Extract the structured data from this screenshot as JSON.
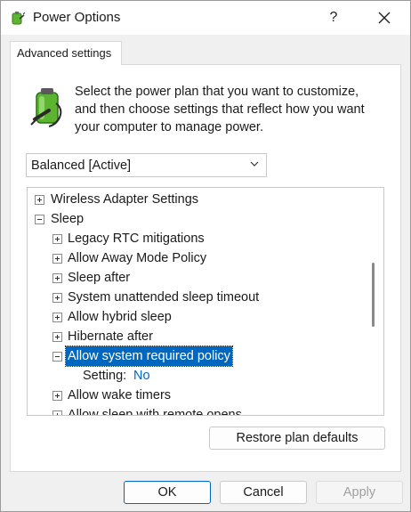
{
  "window": {
    "title": "Power Options",
    "help_label": "?"
  },
  "tab": {
    "label": "Advanced settings"
  },
  "description": "Select the power plan that you want to customize, and then choose settings that reflect how you want your computer to manage power.",
  "plan_select": {
    "value": "Balanced [Active]"
  },
  "tree": {
    "rows": [
      {
        "label": "Wireless Adapter Settings",
        "expander": "plus"
      },
      {
        "label": "Sleep",
        "expander": "minus"
      },
      {
        "label": "Legacy RTC mitigations",
        "expander": "plus"
      },
      {
        "label": "Allow Away Mode Policy",
        "expander": "plus"
      },
      {
        "label": "Sleep after",
        "expander": "plus"
      },
      {
        "label": "System unattended sleep timeout",
        "expander": "plus"
      },
      {
        "label": "Allow hybrid sleep",
        "expander": "plus"
      },
      {
        "label": "Hibernate after",
        "expander": "plus"
      },
      {
        "label": "Allow system required policy",
        "expander": "minus",
        "selected": true
      },
      {
        "label": "Setting:",
        "value": "No"
      },
      {
        "label": "Allow wake timers",
        "expander": "plus"
      },
      {
        "label": "Allow sleep with remote opens",
        "expander": "plus"
      }
    ]
  },
  "buttons": {
    "restore": "Restore plan defaults",
    "ok": "OK",
    "cancel": "Cancel",
    "apply": "Apply"
  },
  "colors": {
    "accent": "#0067c0",
    "battery_green": "#5cb531"
  }
}
